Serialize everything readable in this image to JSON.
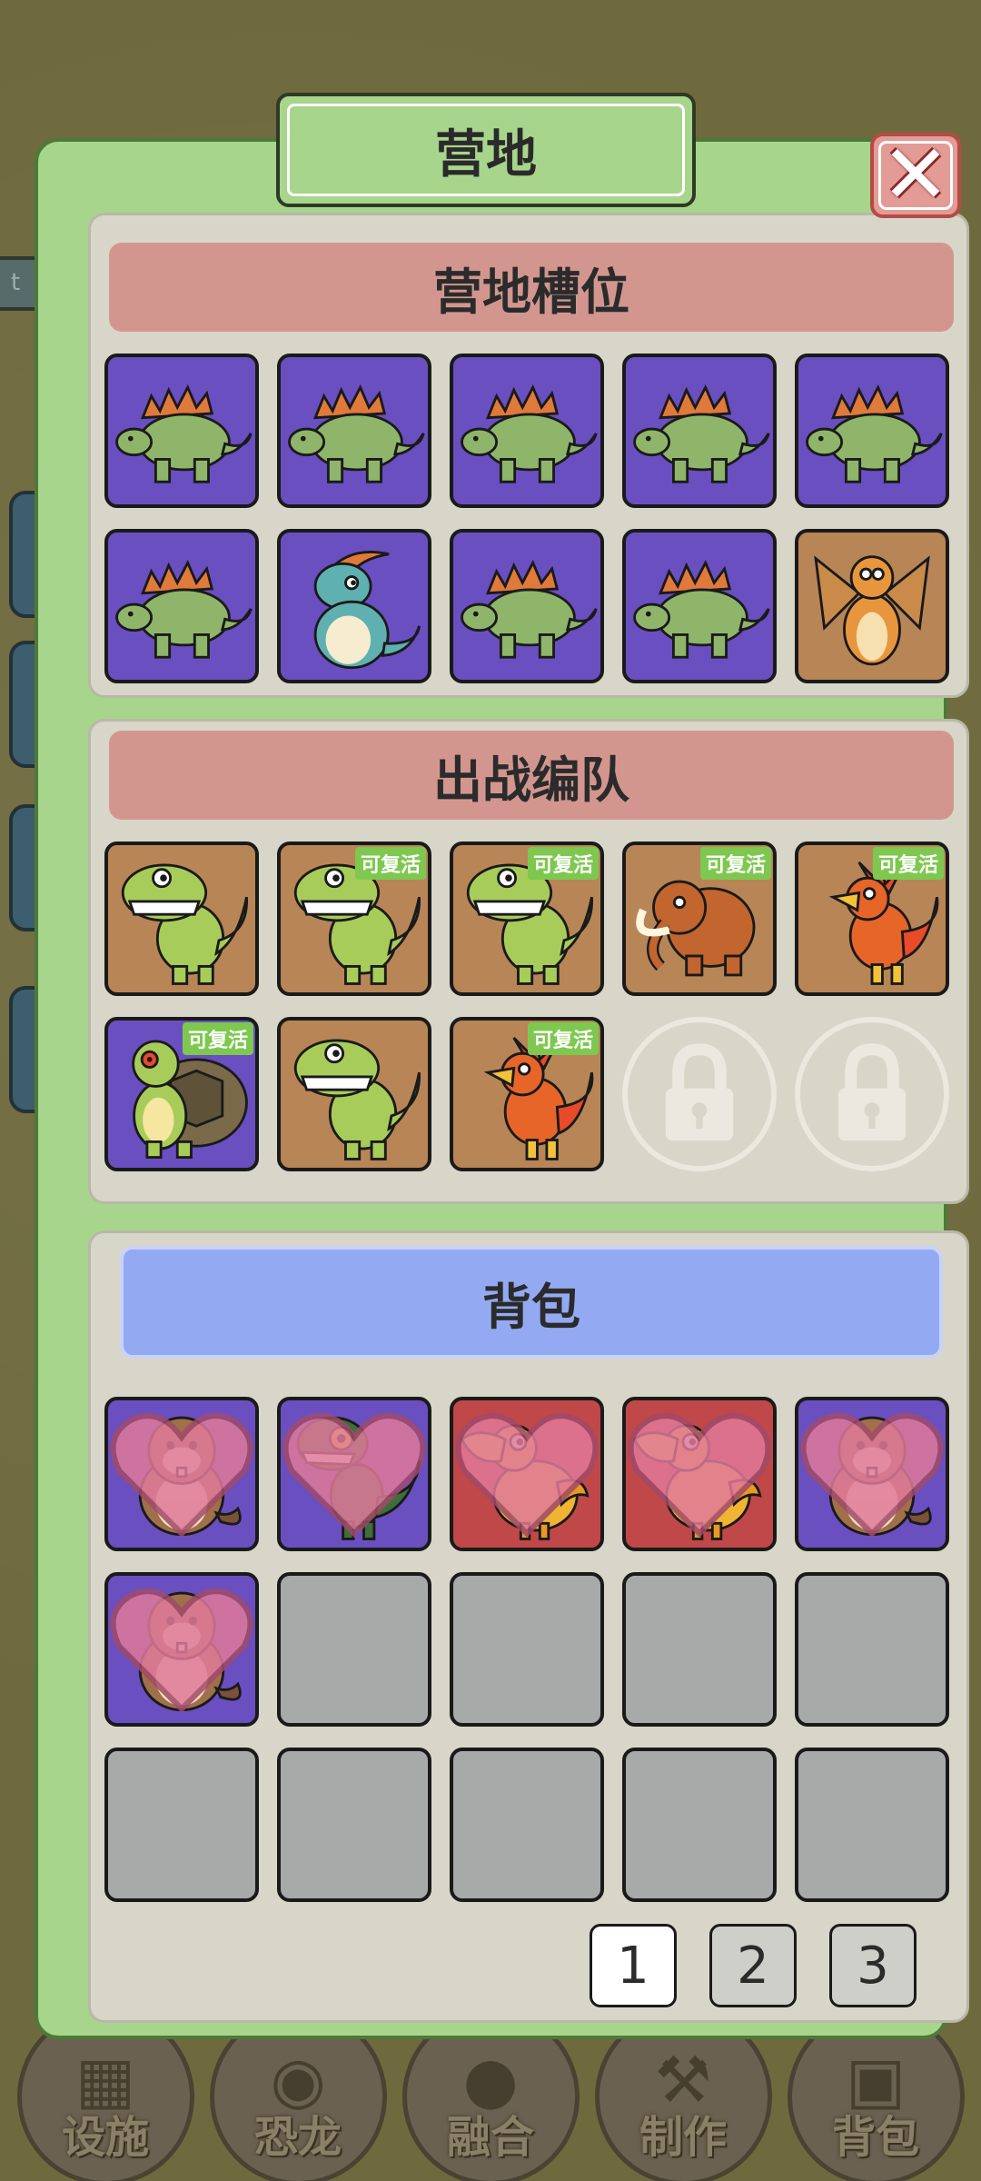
{
  "modal": {
    "title": "营地",
    "close_icon": "close-icon"
  },
  "camp_slots": {
    "header": "营地槽位",
    "items": [
      {
        "creature": "stegosaurus",
        "bg": "purple"
      },
      {
        "creature": "stegosaurus",
        "bg": "purple"
      },
      {
        "creature": "stegosaurus",
        "bg": "purple"
      },
      {
        "creature": "stegosaurus",
        "bg": "purple"
      },
      {
        "creature": "stegosaurus",
        "bg": "purple"
      },
      {
        "creature": "stegosaurus",
        "bg": "purple"
      },
      {
        "creature": "parasaurolophus",
        "bg": "purple"
      },
      {
        "creature": "stegosaurus",
        "bg": "purple"
      },
      {
        "creature": "stegosaurus",
        "bg": "purple"
      },
      {
        "creature": "dragon",
        "bg": "brown"
      }
    ]
  },
  "battle_team": {
    "header": "出战编队",
    "revive_label": "可复活",
    "items": [
      {
        "creature": "trex",
        "bg": "brown",
        "revivable": false
      },
      {
        "creature": "trex",
        "bg": "brown",
        "revivable": true
      },
      {
        "creature": "trex",
        "bg": "brown",
        "revivable": true
      },
      {
        "creature": "mammoth",
        "bg": "brown",
        "revivable": true
      },
      {
        "creature": "phoenix-raptor",
        "bg": "brown",
        "revivable": true
      },
      {
        "creature": "turtle",
        "bg": "purple",
        "revivable": true
      },
      {
        "creature": "trex",
        "bg": "brown",
        "revivable": false
      },
      {
        "creature": "phoenix-raptor",
        "bg": "brown",
        "revivable": true
      },
      {
        "creature": "locked",
        "icon": "lock-icon"
      },
      {
        "creature": "locked",
        "icon": "lock-icon"
      }
    ]
  },
  "backpack": {
    "header": "背包",
    "items": [
      {
        "creature": "beaver",
        "bg": "purple",
        "favorite": true
      },
      {
        "creature": "green-raptor",
        "bg": "purple",
        "favorite": true
      },
      {
        "creature": "dodo",
        "bg": "red",
        "favorite": true
      },
      {
        "creature": "dodo",
        "bg": "red",
        "favorite": true
      },
      {
        "creature": "beaver",
        "bg": "purple",
        "favorite": true
      },
      {
        "creature": "beaver",
        "bg": "purple",
        "favorite": true
      },
      {
        "creature": "empty"
      },
      {
        "creature": "empty"
      },
      {
        "creature": "empty"
      },
      {
        "creature": "empty"
      },
      {
        "creature": "empty"
      },
      {
        "creature": "empty"
      },
      {
        "creature": "empty"
      },
      {
        "creature": "empty"
      },
      {
        "creature": "empty"
      }
    ],
    "pages": [
      "1",
      "2",
      "3"
    ],
    "current_page": "1"
  },
  "bottom_nav": [
    {
      "label": "设施",
      "icon": "fence-icon"
    },
    {
      "label": "恐龙",
      "icon": "dinosaur-icon"
    },
    {
      "label": "融合",
      "icon": "fusion-icon"
    },
    {
      "label": "制作",
      "icon": "hammer-icon"
    },
    {
      "label": "背包",
      "icon": "backpack-icon"
    }
  ],
  "side_tab": {
    "label": "t"
  },
  "colors": {
    "modal_bg": "#a8d58c",
    "section_header": "#d3968f",
    "bag_header": "#93aaf3",
    "revive_badge": "#7ec850",
    "slot_purple": "#6a4fc0",
    "slot_brown": "#b88557",
    "slot_red": "#c04848"
  }
}
